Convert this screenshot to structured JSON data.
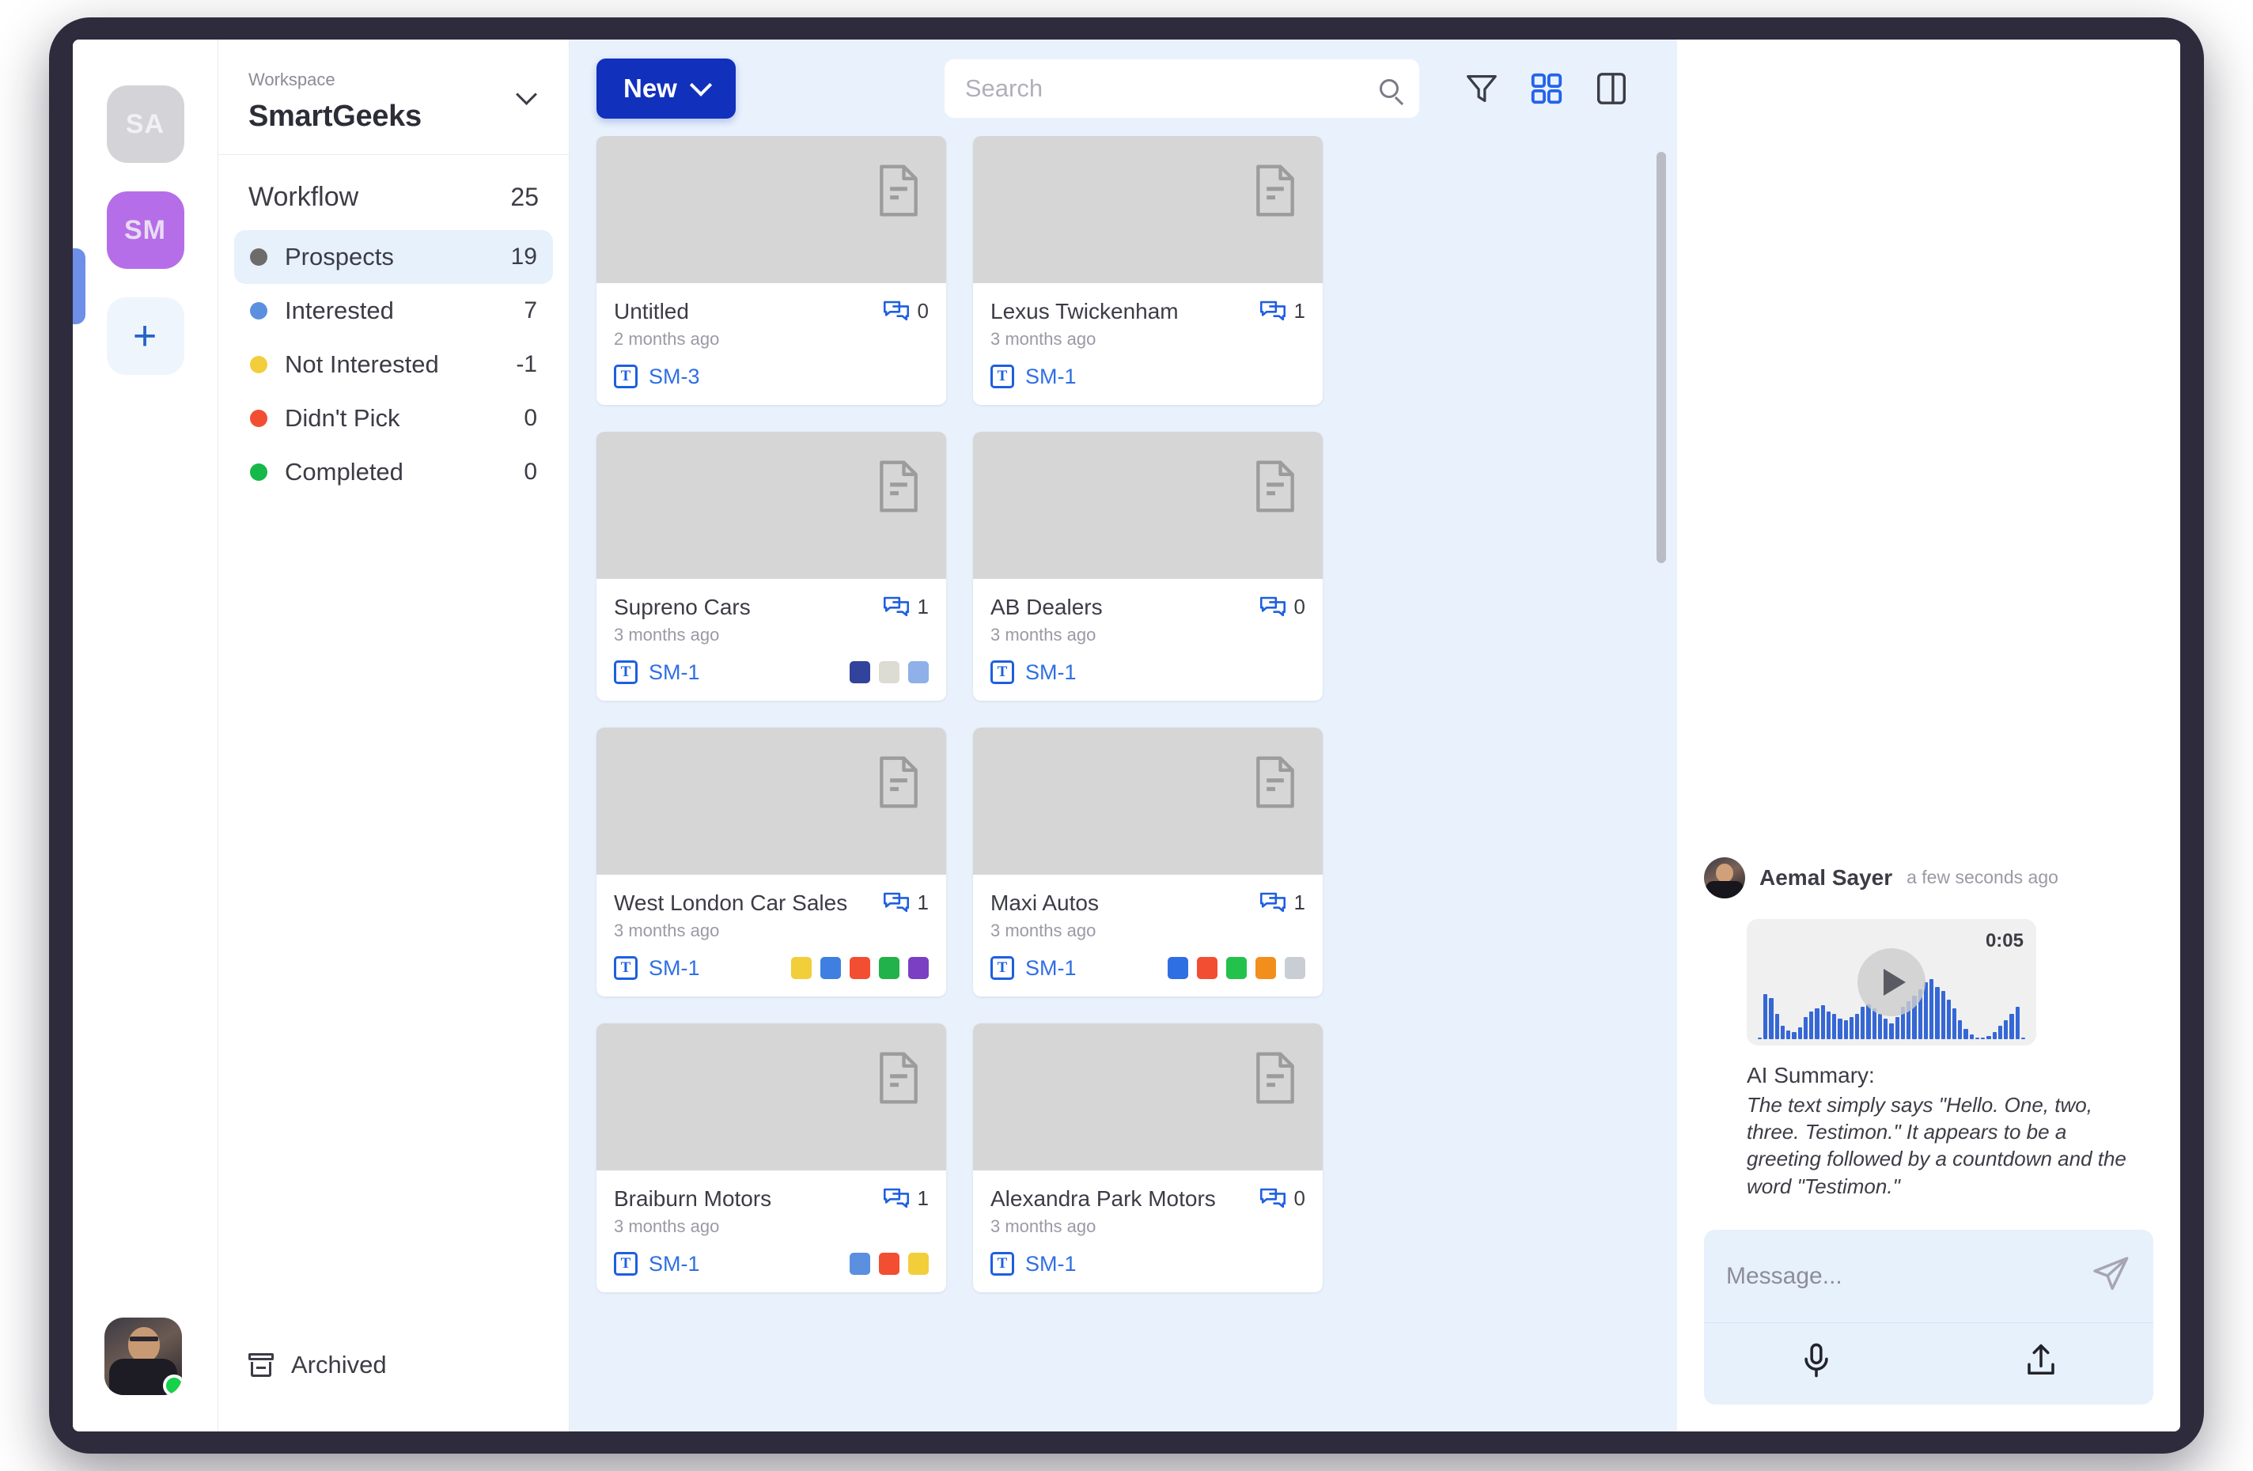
{
  "rail": {
    "tiles": [
      {
        "label": "SA",
        "name": "workspace-avatar-sa"
      },
      {
        "label": "SM",
        "name": "workspace-avatar-sm"
      }
    ],
    "add_label": "+",
    "user_status": "online"
  },
  "sidebar": {
    "workspace_label": "Workspace",
    "workspace_name": "SmartGeeks",
    "workflow_title": "Workflow",
    "workflow_count": "25",
    "items": [
      {
        "label": "Prospects",
        "count": "19",
        "color": "#6e6b6b",
        "active": true
      },
      {
        "label": "Interested",
        "count": "7",
        "color": "#5b8fe0",
        "active": false
      },
      {
        "label": "Not Interested",
        "count": "-1",
        "color": "#f2ce3a",
        "active": false
      },
      {
        "label": "Didn't Pick",
        "count": "0",
        "color": "#f24e32",
        "active": false
      },
      {
        "label": "Completed",
        "count": "0",
        "color": "#15b849",
        "active": false
      }
    ],
    "archived_label": "Archived"
  },
  "toolbar": {
    "new_label": "New",
    "search_placeholder": "Search",
    "search_value": "",
    "icons": [
      {
        "name": "filter-icon",
        "active": false
      },
      {
        "name": "grid-view-icon",
        "active": true
      },
      {
        "name": "board-view-icon",
        "active": false
      }
    ],
    "accent_color": "#1130bb",
    "active_icon_color": "#2563eb"
  },
  "cards": [
    {
      "title": "Untitled",
      "date": "2 months ago",
      "comments": "0",
      "tag": "SM-3",
      "swatches": []
    },
    {
      "title": "Lexus Twickenham",
      "date": "3 months ago",
      "comments": "1",
      "tag": "SM-1",
      "swatches": []
    },
    {
      "title": "Supreno Cars",
      "date": "3 months ago",
      "comments": "1",
      "tag": "SM-1",
      "swatches": [
        "#31439a",
        "#dcdcd4",
        "#8fb0e8"
      ]
    },
    {
      "title": "AB Dealers",
      "date": "3 months ago",
      "comments": "0",
      "tag": "SM-1",
      "swatches": []
    },
    {
      "title": "West London Car Sales",
      "date": "3 months ago",
      "comments": "1",
      "tag": "SM-1",
      "swatches": [
        "#f2ce3a",
        "#3f7fe0",
        "#f24e32",
        "#22b24c",
        "#7b3fc4"
      ]
    },
    {
      "title": "Maxi Autos",
      "date": "3 months ago",
      "comments": "1",
      "tag": "SM-1",
      "swatches": [
        "#2f6fe4",
        "#f24e32",
        "#22c24c",
        "#f28f1c",
        "#c9cdd4"
      ]
    },
    {
      "title": "Braiburn Motors",
      "date": "3 months ago",
      "comments": "1",
      "tag": "SM-1",
      "swatches": [
        "#5b8fe0",
        "#f24e32",
        "#f2ce3a"
      ]
    },
    {
      "title": "Alexandra Park Motors",
      "date": "3 months ago",
      "comments": "0",
      "tag": "SM-1",
      "swatches": []
    }
  ],
  "chat": {
    "message": {
      "author": "Aemal Sayer",
      "time": "a few seconds ago",
      "audio_duration": "0:05",
      "waveform": [
        0,
        62,
        56,
        34,
        18,
        12,
        10,
        16,
        30,
        38,
        42,
        46,
        38,
        34,
        28,
        26,
        30,
        34,
        44,
        48,
        42,
        34,
        28,
        22,
        30,
        44,
        52,
        60,
        68,
        78,
        82,
        72,
        66,
        54,
        42,
        26,
        14,
        6,
        2,
        2,
        4,
        10,
        18,
        26,
        34,
        44,
        0
      ],
      "waveform_color": "#3567d6",
      "summary_title": "AI Summary:",
      "summary_text": "The text simply says \"Hello. One, two, three. Testimon.\" It appears to be a greeting followed by a countdown and the word \"Testimon.\""
    },
    "composer": {
      "placeholder": "Message...",
      "value": "",
      "send_name": "send-icon",
      "mic_name": "microphone-icon",
      "upload_name": "upload-icon"
    }
  }
}
